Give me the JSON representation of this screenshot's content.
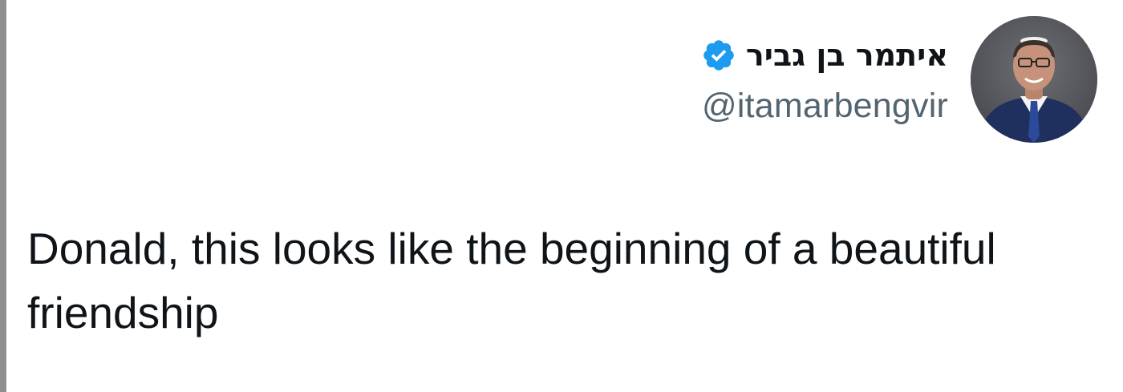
{
  "tweet": {
    "author": {
      "display_name": "איתמר בן גביר",
      "handle": "@itamarbengvir",
      "verified": true,
      "verified_icon": "verified-badge-icon",
      "verified_color": "#1d9bf0"
    },
    "text": "Donald, this looks like the beginning of a beautiful friendship"
  }
}
